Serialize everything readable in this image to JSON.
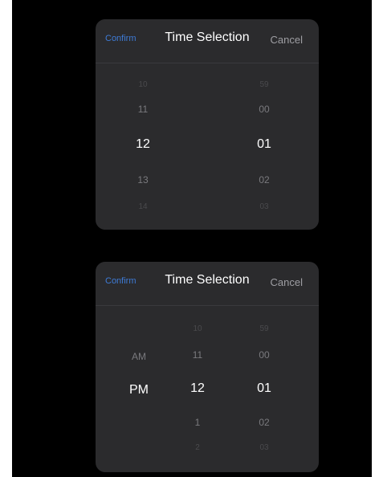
{
  "pickers": [
    {
      "confirm_label": "Confirm",
      "title": "Time Selection",
      "cancel_label": "Cancel",
      "hours": [
        "10",
        "11",
        "12",
        "13",
        "14"
      ],
      "minutes": [
        "59",
        "00",
        "01",
        "02",
        "03"
      ]
    },
    {
      "confirm_label": "Confirm",
      "title": "Time Selection",
      "cancel_label": "Cancel",
      "ampm": [
        "AM",
        "PM"
      ],
      "hours": [
        "10",
        "11",
        "12",
        "1",
        "2"
      ],
      "minutes": [
        "59",
        "00",
        "01",
        "02",
        "03"
      ]
    }
  ],
  "colors": {
    "background": "#000000",
    "sheet": "#2b2b2d",
    "confirm": "#3e7bd6",
    "selected_text": "#ffffff",
    "dim_text": "#77777b"
  }
}
